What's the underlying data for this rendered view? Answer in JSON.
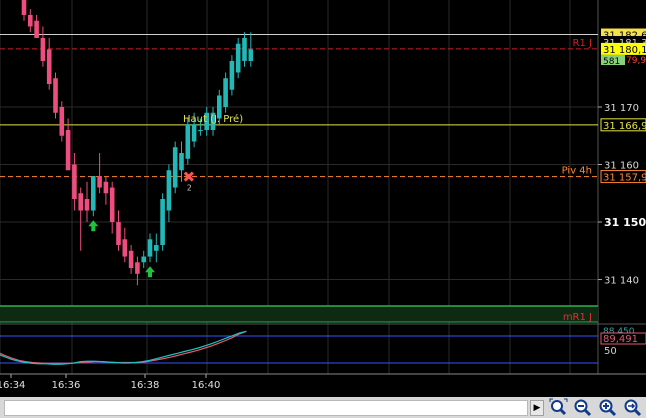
{
  "colors": {
    "background": "#000000",
    "bull": "#22b8b8",
    "bear": "#ee4d7f",
    "grid": "#2a2a2a",
    "r1_line": "#d42020",
    "haut_line": "#e3e34a",
    "piv_line": "#ff8833",
    "mr1_line": "#2fb04f",
    "white_line": "#d0d0d0",
    "osc_blue": "#3355ff",
    "osc_cyan": "#22c0c0",
    "osc_red": "#e05a70",
    "up_arrow": "#22c040"
  },
  "chart_data": {
    "type": "candlestick",
    "x_ticks": [
      "16:34",
      "16:36",
      "16:38",
      "16:40"
    ],
    "y_ticks": [
      31140,
      31150,
      31160,
      31170
    ],
    "y_tick_labels": [
      "31 140",
      "31 150",
      "31 160",
      "31 170"
    ],
    "ylim": [
      31135.4,
      31188.6
    ],
    "candles": [
      {
        "o": 31189,
        "h": 31190,
        "l": 31185,
        "c": 31186
      },
      {
        "o": 31186,
        "h": 31187,
        "l": 31183,
        "c": 31184
      },
      {
        "o": 31185,
        "h": 31186,
        "l": 31182,
        "c": 31182
      },
      {
        "o": 31182,
        "h": 31184,
        "l": 31177,
        "c": 31178
      },
      {
        "o": 31180,
        "h": 31182,
        "l": 31173,
        "c": 31174
      },
      {
        "o": 31175,
        "h": 31176,
        "l": 31168,
        "c": 31169
      },
      {
        "o": 31170,
        "h": 31171,
        "l": 31164,
        "c": 31165
      },
      {
        "o": 31166,
        "h": 31168,
        "l": 31159,
        "c": 31159
      },
      {
        "o": 31160,
        "h": 31162,
        "l": 31152,
        "c": 31154
      },
      {
        "o": 31155,
        "h": 31156,
        "l": 31145,
        "c": 31152
      },
      {
        "o": 31154,
        "h": 31157,
        "l": 31150,
        "c": 31152
      },
      {
        "o": 31152,
        "h": 31158,
        "l": 31151,
        "c": 31158
      },
      {
        "o": 31158,
        "h": 31162,
        "l": 31155,
        "c": 31156
      },
      {
        "o": 31157,
        "h": 31158,
        "l": 31153,
        "c": 31155
      },
      {
        "o": 31156,
        "h": 31157,
        "l": 31148,
        "c": 31150
      },
      {
        "o": 31150,
        "h": 31152,
        "l": 31145,
        "c": 31146
      },
      {
        "o": 31147,
        "h": 31149,
        "l": 31143,
        "c": 31144
      },
      {
        "o": 31145,
        "h": 31146,
        "l": 31141,
        "c": 31142
      },
      {
        "o": 31143,
        "h": 31144,
        "l": 31139,
        "c": 31141
      },
      {
        "o": 31143,
        "h": 31145,
        "l": 31142,
        "c": 31144
      },
      {
        "o": 31144,
        "h": 31148,
        "l": 31143,
        "c": 31147
      },
      {
        "o": 31145,
        "h": 31148,
        "l": 31143,
        "c": 31146
      },
      {
        "o": 31146,
        "h": 31155,
        "l": 31145,
        "c": 31154
      },
      {
        "o": 31152,
        "h": 31160,
        "l": 31150,
        "c": 31159
      },
      {
        "o": 31156,
        "h": 31164,
        "l": 31155,
        "c": 31163
      },
      {
        "o": 31159,
        "h": 31164,
        "l": 31157,
        "c": 31162
      },
      {
        "o": 31161,
        "h": 31168,
        "l": 31160,
        "c": 31167
      },
      {
        "o": 31164,
        "h": 31169,
        "l": 31163,
        "c": 31167
      },
      {
        "o": 31166,
        "h": 31168,
        "l": 31165,
        "c": 31166
      },
      {
        "o": 31166,
        "h": 31170,
        "l": 31165,
        "c": 31169
      },
      {
        "o": 31166,
        "h": 31170,
        "l": 31165,
        "c": 31169
      },
      {
        "o": 31168,
        "h": 31173,
        "l": 31167,
        "c": 31172
      },
      {
        "o": 31170,
        "h": 31176,
        "l": 31169,
        "c": 31175
      },
      {
        "o": 31173,
        "h": 31179,
        "l": 31172,
        "c": 31178
      },
      {
        "o": 31176,
        "h": 31182,
        "l": 31175,
        "c": 31181
      },
      {
        "o": 31178,
        "h": 31183,
        "l": 31177,
        "c": 31182
      },
      {
        "o": 31178,
        "h": 31183,
        "l": 31177,
        "c": 31180
      }
    ],
    "levels": [
      {
        "name": "R1 J",
        "value": 31180.1,
        "label": "31 180,1",
        "color": "#d42020",
        "style": "dashed"
      },
      {
        "name": "Haut (J. Pré)",
        "value": 31166.9,
        "label": "31 166,9",
        "color": "#e3e34a",
        "style": "solid"
      },
      {
        "name": "Piv 4h",
        "value": 31157.9,
        "label": "31 157,9",
        "color": "#ff8833",
        "style": "dashed"
      },
      {
        "name": "",
        "value": 31182.6,
        "label": "31 182,6",
        "color": "#d0d0d0",
        "style": "solid"
      },
      {
        "name": "",
        "value": 31181.3,
        "label": "31 181,3",
        "color": "#d0d0d0",
        "style": "none"
      }
    ],
    "partial_labels": [
      "79,9",
      "581"
    ],
    "mr1_label": "mR1 J",
    "marker_label": "2",
    "arrows_at": [
      11,
      20
    ],
    "cross_at": 26,
    "oscillator": {
      "yticks": [
        "50"
      ],
      "value_labels": [
        "88,450",
        "89,491"
      ],
      "line1": [
        36,
        30,
        24,
        20,
        17,
        15,
        14,
        14,
        13,
        13,
        14,
        16,
        19,
        20,
        20,
        19,
        18,
        17,
        16,
        16,
        17,
        19,
        22,
        26,
        30,
        34,
        38,
        42,
        46,
        50,
        55,
        60,
        66,
        72,
        78,
        84,
        88
      ],
      "line2": [
        40,
        33,
        27,
        22,
        19,
        17,
        16,
        15,
        15,
        15,
        15,
        16,
        17,
        18,
        19,
        19,
        18,
        17,
        17,
        17,
        17,
        18,
        20,
        23,
        26,
        29,
        33,
        37,
        41,
        45,
        50,
        55,
        61,
        67,
        74,
        82,
        88
      ]
    }
  },
  "scrollbar": {
    "arrow_left": "◀",
    "arrow_right": "▶"
  },
  "toolbar": {
    "icons": [
      "zoom-fit-icon",
      "zoom-out-icon",
      "zoom-in-icon",
      "zoom-auto-icon"
    ]
  }
}
